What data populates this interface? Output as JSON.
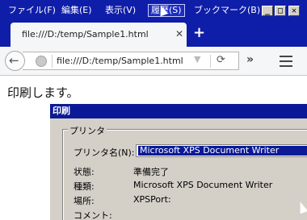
{
  "menubar": {
    "items": [
      {
        "label": "ファイル(F)"
      },
      {
        "label": "編集(E)"
      },
      {
        "label": "表示(V)"
      },
      {
        "label": "履歴(S)"
      },
      {
        "label": "ブックマーク(B)"
      }
    ],
    "window_buttons": {
      "minimize": "_",
      "maximize": "□",
      "close": "✕"
    }
  },
  "tab": {
    "title": "file:///D:/temp/Sample1.html",
    "close": "✕"
  },
  "newtab": {
    "label": "+"
  },
  "navbar": {
    "url": "file:///D:/temp/Sample1.html",
    "dropdown_glyph": "▼",
    "reload_glyph": "⟳",
    "overflow_glyph": "»"
  },
  "page": {
    "text": "印刷します。"
  },
  "print_dialog": {
    "title": "印刷",
    "group_label": "プリンタ",
    "printer_name_label": "プリンタ名(N):",
    "printer_name_value": "Microsoft XPS Document Writer",
    "status_label": "状態:",
    "status_value": "準備完了",
    "type_label": "種類:",
    "type_value": "Microsoft XPS Document Writer",
    "location_label": "場所:",
    "location_value": "XPSPort:",
    "comment_label": "コメント:"
  },
  "colors": {
    "title_bar": "#0f1ea8",
    "dialog_face": "#d4d0c8",
    "dialog_title": "#0a1a96",
    "toolbar": "#f5f6f7"
  }
}
